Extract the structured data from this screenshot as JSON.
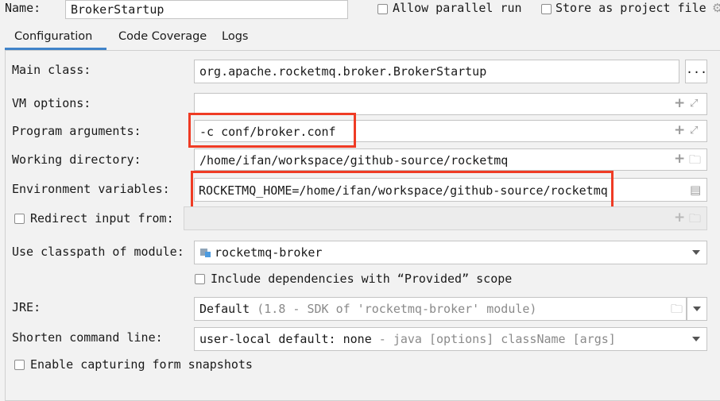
{
  "header": {
    "name_label": "Name:",
    "name_value": "BrokerStartup",
    "allow_parallel": "Allow parallel run",
    "store_as_project": "Store as project file"
  },
  "tabs": [
    "Configuration",
    "Code Coverage",
    "Logs"
  ],
  "form": {
    "main_class_label": "Main class:",
    "main_class_value": "org.apache.rocketmq.broker.BrokerStartup",
    "browse_button": "...",
    "vm_options_label": "VM options:",
    "vm_options_value": "",
    "program_args_label": "Program arguments:",
    "program_args_value": "-c conf/broker.conf",
    "working_dir_label": "Working directory:",
    "working_dir_value": "/home/ifan/workspace/github-source/rocketmq",
    "env_vars_label": "Environment variables:",
    "env_vars_value": "ROCKETMQ_HOME=/home/ifan/workspace/github-source/rocketmq",
    "redirect_label": "Redirect input from:",
    "classpath_label": "Use classpath of module:",
    "classpath_value": "rocketmq-broker",
    "include_deps_label": "Include dependencies with “Provided” scope",
    "jre_label": "JRE:",
    "jre_value": "Default",
    "jre_hint": "(1.8 - SDK of 'rocketmq-broker' module)",
    "shorten_label": "Shorten command line:",
    "shorten_value": "user-local default: none",
    "shorten_hint": "- java [options] className [args]",
    "capture_label": "Enable capturing form snapshots"
  },
  "colors": {
    "highlight": "#ef3b24",
    "tab_underline": "#4083c9"
  }
}
